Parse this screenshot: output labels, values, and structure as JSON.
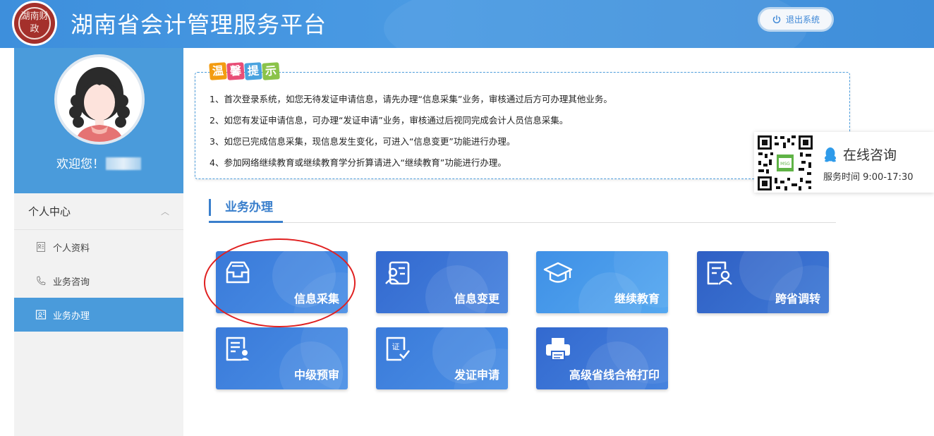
{
  "header": {
    "logo_text": "湖南财政",
    "title": "湖南省会计管理服务平台",
    "logout_label": "退出系统"
  },
  "sidebar": {
    "welcome": "欢迎您！",
    "menu_group": "个人中心",
    "items": [
      {
        "label": "个人资料",
        "icon": "profile-card-icon"
      },
      {
        "label": "业务咨询",
        "icon": "phone-icon"
      },
      {
        "label": "业务办理",
        "icon": "business-icon",
        "active": true
      }
    ]
  },
  "tips": {
    "title_chars": [
      "温",
      "馨",
      "提",
      "示"
    ],
    "title_colors": [
      "#f39c12",
      "#e94e77",
      "#4aa3df",
      "#8bc34a"
    ],
    "lines": [
      "1、首次登录系统，如您无待发证申请信息，请先办理“信息采集”业务，审核通过后方可办理其他业务。",
      "2、如您有发证申请信息，可办理“发证申请”业务，审核通过后视同完成会计人员信息采集。",
      "3、如您已完成信息采集，现信息发生变化，可进入“信息变更”功能进行办理。",
      "4、参加网络继续教育或继续教育学分折算请进入“继续教育”功能进行办理。"
    ]
  },
  "consult": {
    "label": "在线咨询",
    "service_time": "服务时间 9:00-17:30"
  },
  "section": {
    "title": "业务办理"
  },
  "tiles": [
    {
      "label": "信息采集",
      "icon": "inbox-tray-icon"
    },
    {
      "label": "信息变更",
      "icon": "person-card-edit-icon"
    },
    {
      "label": "继续教育",
      "icon": "graduation-cap-icon"
    },
    {
      "label": "跨省调转",
      "icon": "person-document-icon"
    },
    {
      "label": "中级预审",
      "icon": "form-review-icon"
    },
    {
      "label": "发证申请",
      "icon": "certificate-icon"
    },
    {
      "label": "高级省线合格打印",
      "icon": "printer-icon"
    }
  ],
  "colors": {
    "header_bg": "#4a9ae3",
    "sidebar_active": "#4a9bdb",
    "accent": "#3a7fcc",
    "highlight_circle": "#e02020"
  }
}
